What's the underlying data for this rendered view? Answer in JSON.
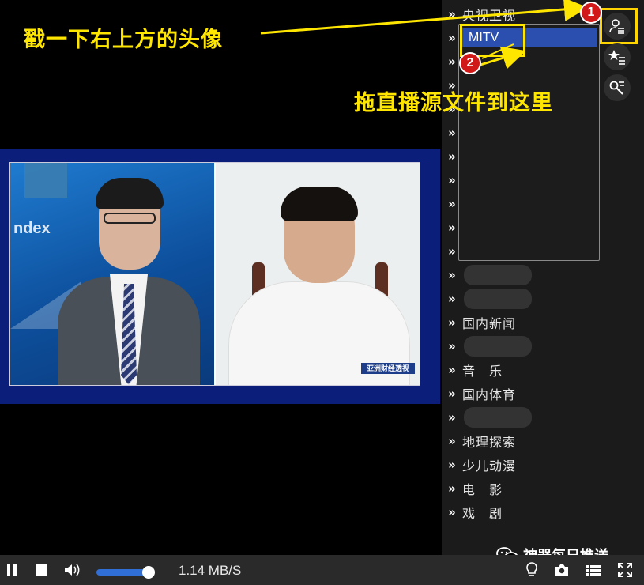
{
  "player": {
    "download_rate": "1.14 MB/S",
    "video_logo": "亚洲财经透视"
  },
  "video": {
    "background_word": "ndex"
  },
  "channels": [
    {
      "label": "央视卫视"
    },
    {
      "label": ""
    },
    {
      "label": ""
    },
    {
      "label": ""
    },
    {
      "label": ""
    },
    {
      "label": ""
    },
    {
      "label": ""
    },
    {
      "label": ""
    },
    {
      "label": ""
    },
    {
      "label": ""
    },
    {
      "label": ""
    },
    {
      "label": ""
    },
    {
      "label": ""
    },
    {
      "label": "国内新闻"
    },
    {
      "label": ""
    },
    {
      "label": "音　乐"
    },
    {
      "label": "国内体育"
    },
    {
      "label": ""
    },
    {
      "label": "地理探索"
    },
    {
      "label": "少儿动漫"
    },
    {
      "label": "电　影"
    },
    {
      "label": "戏　剧"
    }
  ],
  "dropdown": {
    "selected": "MITV"
  },
  "annotations": {
    "step1_text": "戳一下右上方的头像",
    "step2_text": "拖直播源文件到这里",
    "badge1": "1",
    "badge2": "2",
    "accent_color": "#ffe600"
  },
  "watermark": {
    "text": "神器每日推送"
  },
  "icons": {
    "side": [
      "user-list-icon",
      "star-list-icon",
      "key-search-icon"
    ],
    "controls": [
      "pause-icon",
      "stop-icon",
      "volume-icon",
      "bulb-icon",
      "camera-icon",
      "playlist-icon",
      "fullscreen-icon"
    ]
  }
}
